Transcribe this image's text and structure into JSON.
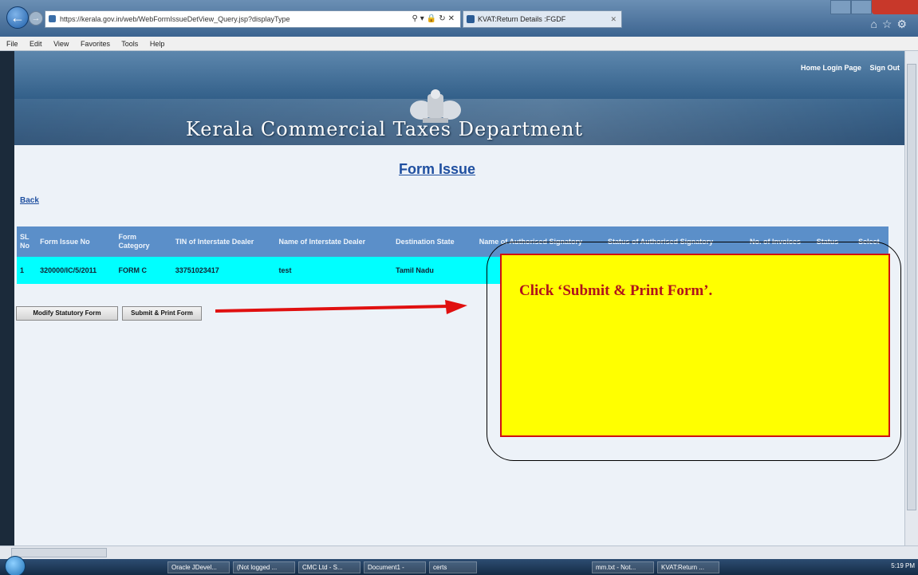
{
  "browser": {
    "url_host": "kerala.gov.in",
    "url_prefix": "https://",
    "url_path": "/web/WebFormIssueDetView_Query.jsp?displayType",
    "tab_title": "KVAT:Return Details :FGDF",
    "menu": [
      "File",
      "Edit",
      "View",
      "Favorites",
      "Tools",
      "Help"
    ]
  },
  "banner": {
    "title": "Kerala Commercial Taxes Department",
    "links": [
      "Home Login Page",
      "Sign Out"
    ]
  },
  "page": {
    "title": "Form Issue",
    "back_label": "Back"
  },
  "table": {
    "headers": [
      "SL No",
      "Form Issue No",
      "Form Category",
      "TIN of Interstate Dealer",
      "Name of Interstate Dealer",
      "Destination State",
      "Name of Authorised Signatory",
      "Status of Authorised Signatory",
      "No. of Invoices",
      "Status",
      "Select"
    ],
    "rows": [
      [
        "1",
        "320000/IC/5/2011",
        "FORM C",
        "33751023417",
        "test",
        "Tamil Nadu",
        "",
        "",
        "",
        "",
        ""
      ]
    ]
  },
  "buttons": {
    "modify": "Modify Statutory Form",
    "submit": "Submit & Print Form"
  },
  "callout": {
    "text": "Click ‘Submit & Print Form’."
  },
  "taskbar": {
    "items": [
      "Oracle JDevel...",
      "(Not logged ...",
      "CMC Ltd - S...",
      "Document1 -",
      "certs",
      "mm.txt - Not...",
      "KVAT:Return ..."
    ],
    "clock": "5:19 PM"
  }
}
